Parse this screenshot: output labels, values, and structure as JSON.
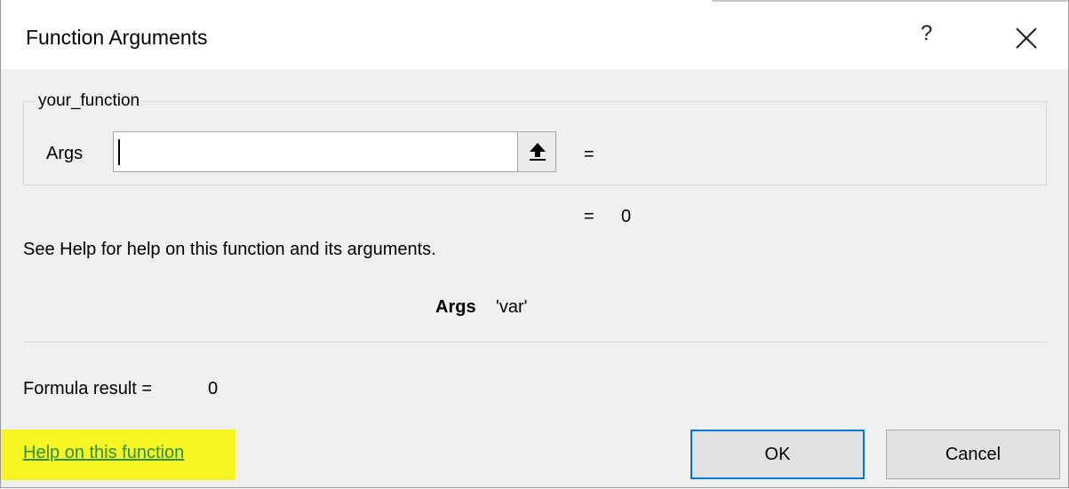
{
  "dialog": {
    "title": "Function Arguments",
    "help_glyph": "?",
    "close_glyph": "×"
  },
  "function_group": {
    "name": "your_function",
    "arg_label": "Args",
    "arg_value": "",
    "arg_equals": "=",
    "collapse_icon": "upload-arrow-icon"
  },
  "evaluation": {
    "equals": "=",
    "value": "0"
  },
  "description": "See Help for help on this function and its arguments.",
  "argument_help": {
    "name": "Args",
    "text": "'var'"
  },
  "formula_result": {
    "label": "Formula result =",
    "value": "0"
  },
  "help_link": {
    "label": "Help on this function",
    "highlight_color": "#f6f624"
  },
  "buttons": {
    "ok": "OK",
    "cancel": "Cancel"
  },
  "colors": {
    "accent": "#0078d7",
    "link": "#2f8f3f"
  }
}
